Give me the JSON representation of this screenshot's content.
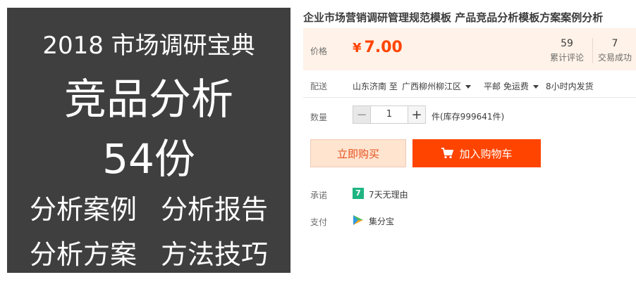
{
  "product_image": {
    "line1": "2018 市场调研宝典",
    "line2": "竞品分析",
    "line3": "54份",
    "line4": [
      "分析案例",
      "分析报告"
    ],
    "line5": [
      "分析方案",
      "方法技巧"
    ],
    "background": "#3f3f3f"
  },
  "title": "企业市场营销调研管理规范模板 产品竞品分析模板方案案例分析",
  "price": {
    "label": "价格",
    "currency": "¥",
    "value": "7.00",
    "color": "#ff4400"
  },
  "stats": {
    "reviews_count": "59",
    "reviews_label": "累计评论",
    "sales_count": "7",
    "sales_label": "交易成功"
  },
  "shipping": {
    "label": "配送",
    "from": "山东济南 至",
    "to": "广西柳州柳江区",
    "method": "平邮 免运费",
    "dispatch": "8小时内发货"
  },
  "quantity": {
    "label": "数量",
    "minus": "−",
    "value": "1",
    "plus": "+",
    "stock": "件(库存999641件)"
  },
  "actions": {
    "buy_now": "立即购买",
    "add_to_cart": "加入购物车",
    "cart_icon": "shopping-cart-icon"
  },
  "promise": {
    "label": "承诺",
    "icon_text": "7",
    "icon": "seven-days-icon",
    "text": "7天无理由"
  },
  "payment": {
    "label": "支付",
    "icon": "jifenbao-icon",
    "text": "集分宝"
  },
  "colors": {
    "accent": "#ff4400",
    "price_bg": "#fff2e8",
    "promise_green": "#1fb583"
  }
}
